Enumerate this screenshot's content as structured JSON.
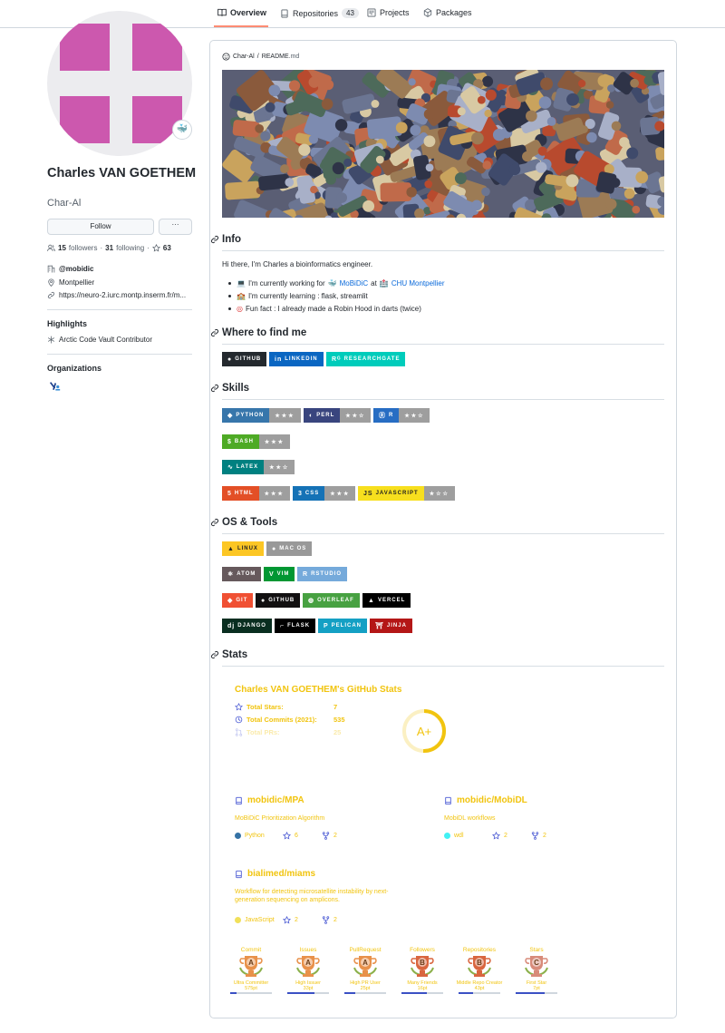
{
  "nav": {
    "tabs": [
      {
        "label": "Overview",
        "icon": "book-icon"
      },
      {
        "label": "Repositories",
        "icon": "repo-icon",
        "count": "43"
      },
      {
        "label": "Projects",
        "icon": "project-icon"
      },
      {
        "label": "Packages",
        "icon": "package-icon"
      }
    ]
  },
  "profile": {
    "name": "Charles VAN GOETHEM",
    "login": "Char-Al",
    "status_emoji": "🐳",
    "follow_label": "Follow",
    "more_label": "···",
    "followers_count": "15",
    "followers_label": "followers",
    "following_count": "31",
    "following_label": "following",
    "stars_count": "63",
    "org": "@mobidic",
    "location": "Montpellier",
    "website": "https://neuro-2.iurc.montp.inserm.fr/m...",
    "highlights_title": "Highlights",
    "highlight_item": "Arctic Code Vault Contributor",
    "organizations_title": "Organizations"
  },
  "readme": {
    "crumb_user": "Char-Al",
    "crumb_sep": "/",
    "crumb_file": "README",
    ".md": ".md",
    "crumb_ext": ".md",
    "info_title": "Info",
    "intro": "Hi there, I'm Charles a bioinformatics engineer.",
    "li1_a": "I'm currently working for",
    "li1_b": "MoBiDiC",
    "li1_c": "at",
    "li1_d": "CHU Montpellier",
    "li2": "I'm currently learning : flask, streamlit",
    "li3": "Fun fact : I already made a Robin Hood in darts (twice)",
    "find_title": "Where to find me",
    "skills_title": "Skills",
    "os_title": "OS & Tools",
    "stats_title": "Stats"
  },
  "find_badges": [
    {
      "label": "GITHUB",
      "color": "#24292e"
    },
    {
      "label": "LINKEDIN",
      "color": "#0a66c2"
    },
    {
      "label": "RESEARCHGATE",
      "color": "#00ccbb"
    }
  ],
  "skill_badges": [
    {
      "label": "PYTHON",
      "rating": "★★★",
      "color": "#3776ab"
    },
    {
      "label": "PERL",
      "rating": "★★☆",
      "color": "#39457e"
    },
    {
      "label": "R",
      "rating": "★★☆",
      "color": "#276dc3"
    },
    {
      "label": "BASH",
      "rating": "★★★",
      "color": "#4eaa25"
    },
    {
      "label": "LATEX",
      "rating": "★★☆",
      "color": "#008080"
    },
    {
      "label": "HTML",
      "rating": "★★★",
      "color": "#e34f26"
    },
    {
      "label": "CSS",
      "rating": "★★★",
      "color": "#1572b6"
    },
    {
      "label": "JAVASCRIPT",
      "rating": "★☆☆",
      "color": "#f7df1e"
    }
  ],
  "tool_badges": [
    {
      "label": "LINUX",
      "color": "#fcc624"
    },
    {
      "label": "MAC OS",
      "color": "#999999"
    },
    {
      "label": "ATOM",
      "color": "#66595c"
    },
    {
      "label": "VIM",
      "color": "#019733"
    },
    {
      "label": "RSTUDIO",
      "color": "#75aadb"
    },
    {
      "label": "GIT",
      "color": "#f05033"
    },
    {
      "label": "GITHUB",
      "color": "#121011"
    },
    {
      "label": "OVERLEAF",
      "color": "#47a141"
    },
    {
      "label": "VERCEL",
      "color": "#000000"
    },
    {
      "label": "DJANGO",
      "color": "#092e20"
    },
    {
      "label": "FLASK",
      "color": "#000000"
    },
    {
      "label": "PELICAN",
      "color": "#14a0c4"
    },
    {
      "label": "JINJA",
      "color": "#b41717"
    }
  ],
  "gh_stats": {
    "title": "Charles VAN GOETHEM's GitHub Stats",
    "rows": [
      {
        "label": "Total Stars:",
        "value": "7"
      },
      {
        "label": "Total Commits (2021):",
        "value": "535"
      },
      {
        "label": "Total PRs:",
        "value": "25"
      }
    ],
    "grade": "A+"
  },
  "repos": [
    {
      "name": "mobidic/MPA",
      "desc": "MoBiDiC Prioritization Algorithm",
      "lang": "Python",
      "lang_color": "#3572a5",
      "stars": "6",
      "forks": "2"
    },
    {
      "name": "mobidic/MobiDL",
      "desc": "MobiDL workflows",
      "lang": "wdl",
      "lang_color": "#42f1f4",
      "stars": "2",
      "forks": "2"
    },
    {
      "name": "bialimed/miams",
      "desc": "Workflow for detecting microsatellite instability by next-generation sequencing on amplicons.",
      "lang": "JavaScript",
      "lang_color": "#f1e05a",
      "stars": "2",
      "forks": "2"
    }
  ],
  "trophies": [
    {
      "title": "Commit",
      "rank": "A",
      "sub": "Ultra Committer",
      "pts": "575pt",
      "progress": 0.15
    },
    {
      "title": "Issues",
      "rank": "A",
      "sub": "High Issuer",
      "pts": "33pt",
      "progress": 0.65
    },
    {
      "title": "PullRequest",
      "rank": "A",
      "sub": "High PR User",
      "pts": "25pt",
      "progress": 0.25
    },
    {
      "title": "Followers",
      "rank": "B",
      "sub": "Many Friends",
      "pts": "16pt",
      "progress": 0.6
    },
    {
      "title": "Repositories",
      "rank": "B",
      "sub": "Middle Repo Creator",
      "pts": "43pt",
      "progress": 0.35
    },
    {
      "title": "Stars",
      "rank": "C",
      "sub": "First Star",
      "pts": "7pt",
      "progress": 0.7
    }
  ],
  "colors": {
    "accent_tab": "#fd8c73",
    "avatar_pink": "#cc58ae",
    "stats_yellow": "#f1c40f",
    "link_blue": "#0969da"
  }
}
